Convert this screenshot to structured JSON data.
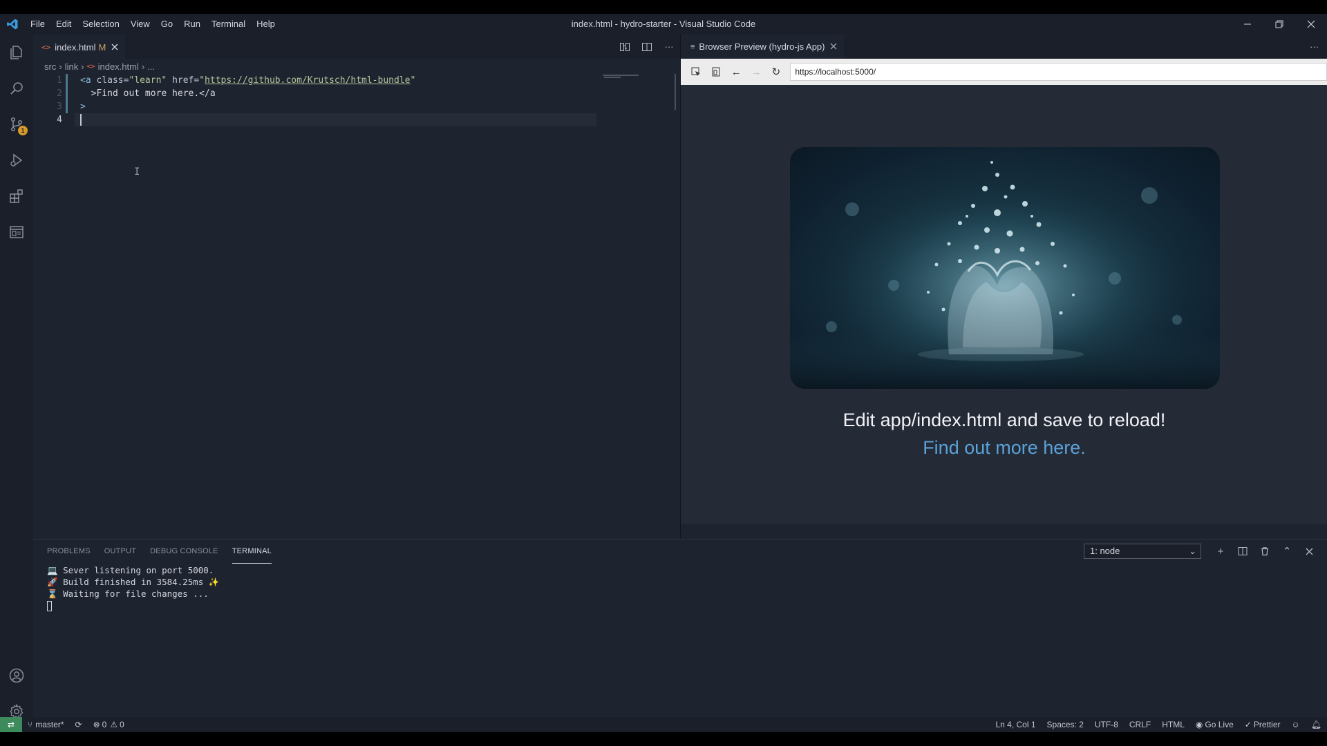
{
  "window": {
    "title": "index.html - hydro-starter - Visual Studio Code",
    "menu": [
      "File",
      "Edit",
      "Selection",
      "View",
      "Go",
      "Run",
      "Terminal",
      "Help"
    ]
  },
  "activity_bar": {
    "source_control_badge": "1"
  },
  "editor": {
    "tab": {
      "label": "index.html",
      "modified": "M"
    },
    "breadcrumb": [
      "src",
      "link",
      "index.html",
      "..."
    ],
    "line_numbers": [
      "1",
      "2",
      "3",
      "4"
    ],
    "code": {
      "l1_tag_open": "<a",
      "l1_attr_class": " class=",
      "l1_class_val": "\"learn\"",
      "l1_attr_href": " href=",
      "l1_quote": "\"",
      "l1_url": "https://github.com/Krutsch/html-bundle",
      "l1_quote_end": "\"",
      "l2_text": "  >Find out more here.</a",
      "l3_text": ">"
    }
  },
  "browser": {
    "tab_label": "Browser Preview (hydro-js App)",
    "url": "https://localhost:5000/",
    "heading": "Edit app/index.html and save to reload!",
    "link": "Find out more here."
  },
  "panel": {
    "tabs": [
      "PROBLEMS",
      "OUTPUT",
      "DEBUG CONSOLE",
      "TERMINAL"
    ],
    "active_tab": "TERMINAL",
    "terminal_select": "1: node",
    "lines": [
      "💻 Sever listening on port 5000.",
      "🚀 Build finished in 3584.25ms ✨",
      "⌛ Waiting for file changes ..."
    ]
  },
  "statusbar": {
    "branch": "master*",
    "errors": "0",
    "warnings": "0",
    "position": "Ln 4, Col 1",
    "spaces": "Spaces: 2",
    "encoding": "UTF-8",
    "eol": "CRLF",
    "language": "HTML",
    "go_live": "Go Live",
    "prettier": "Prettier"
  },
  "colors": {
    "editor_bg": "#1e2330",
    "sidebar_bg": "#1b1f2a",
    "link": "#5aa2d8",
    "remote_indicator": "#3d8a5c"
  }
}
